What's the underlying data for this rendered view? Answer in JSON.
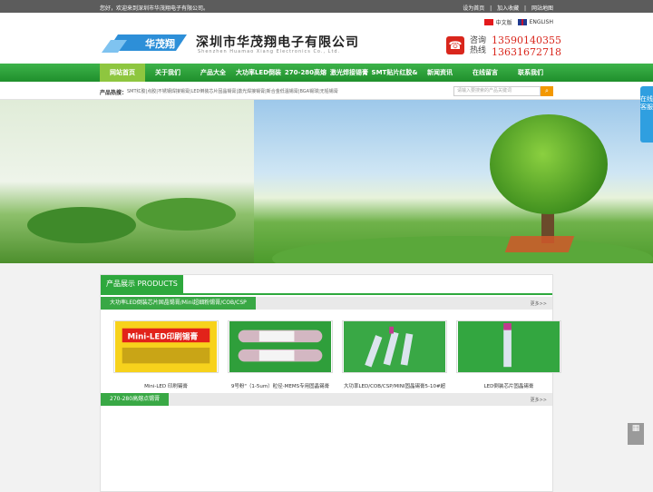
{
  "topbar": {
    "welcome": "您好，欢迎来到深圳市华茂翔电子有限公司。",
    "links": [
      "设为首页",
      "|",
      "加入收藏",
      "|",
      "网站地图"
    ]
  },
  "header": {
    "lang_cn": "中文版",
    "lang_en": "ENGLISH",
    "company_cn": "深圳市华茂翔电子有限公司",
    "company_en": "Shenzhen Huamao Xiang Electronics Co., Ltd.",
    "logo_text": "华茂翔",
    "hotline_label_1": "咨询",
    "hotline_label_2": "热线",
    "phone_1": "13590140355",
    "phone_2": "13631672718"
  },
  "nav": [
    "网站首页",
    "关于我们",
    "产品大全",
    "大功率LED倒装",
    "270-280高熔点",
    "激光焊接锡膏",
    "SMT贴片红胶&",
    "新闻资讯",
    "在线留言",
    "联系我们"
  ],
  "hot": {
    "label": "产品热搜：",
    "words": "SMT红胶|点胶|不锈钢焊接锡膏|LED倒装芯片固晶锡膏|激光焊接锡膏|新合金低温锡膏|BGA锡球|无铅锡膏",
    "search_placeholder": "请输入要搜索的产品关键词"
  },
  "side_float": "在线客服",
  "panel": {
    "title": "产品展示 PRODUCTS",
    "category_1": "大功率LED倒装芯片固晶锡膏/Mini超细粉锡膏/COB/CSP",
    "category_2": "270-280高熔点锡膏",
    "more": "更多>>"
  },
  "products": [
    {
      "caption": "Mini-LED 印刷锡膏",
      "img_text": "Mini-LED印刷锡膏"
    },
    {
      "caption": "9号粉\"（1-5um）粒径-MEMS专用固晶锡膏",
      "img_text": ""
    },
    {
      "caption": "大功率LED/COB/CSP/MINI固晶锡膏5-10#超",
      "img_text": ""
    },
    {
      "caption": "LED倒装芯片固晶锡膏",
      "img_text": ""
    }
  ]
}
